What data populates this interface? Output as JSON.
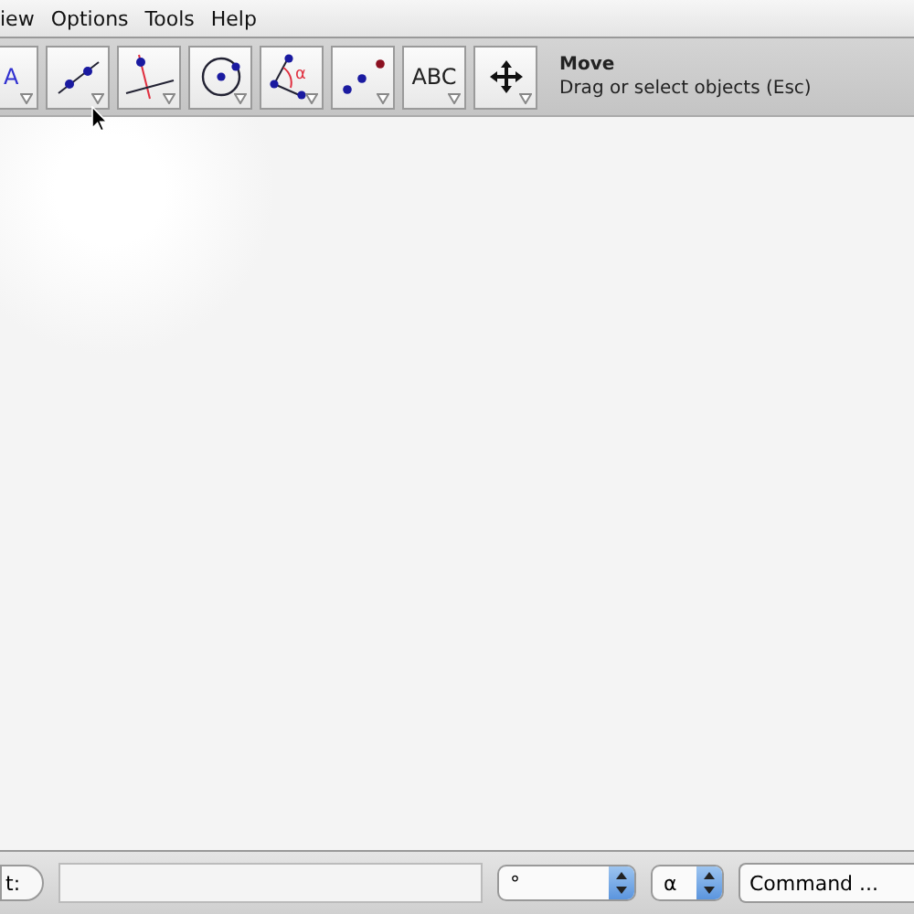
{
  "menu": [
    "iew",
    "Options",
    "Tools",
    "Help"
  ],
  "tools": [
    {
      "kind": "text",
      "label": "A"
    },
    {
      "kind": "line"
    },
    {
      "kind": "perpendicular"
    },
    {
      "kind": "circle"
    },
    {
      "kind": "angle",
      "label": "α"
    },
    {
      "kind": "points"
    },
    {
      "kind": "text",
      "label": "ABC"
    },
    {
      "kind": "move"
    }
  ],
  "tool_help": {
    "title": "Move",
    "description": "Drag or select objects (Esc)"
  },
  "input_bar": {
    "button": "t:",
    "angle_unit": "°",
    "symbol": "α",
    "command": "Command ..."
  }
}
